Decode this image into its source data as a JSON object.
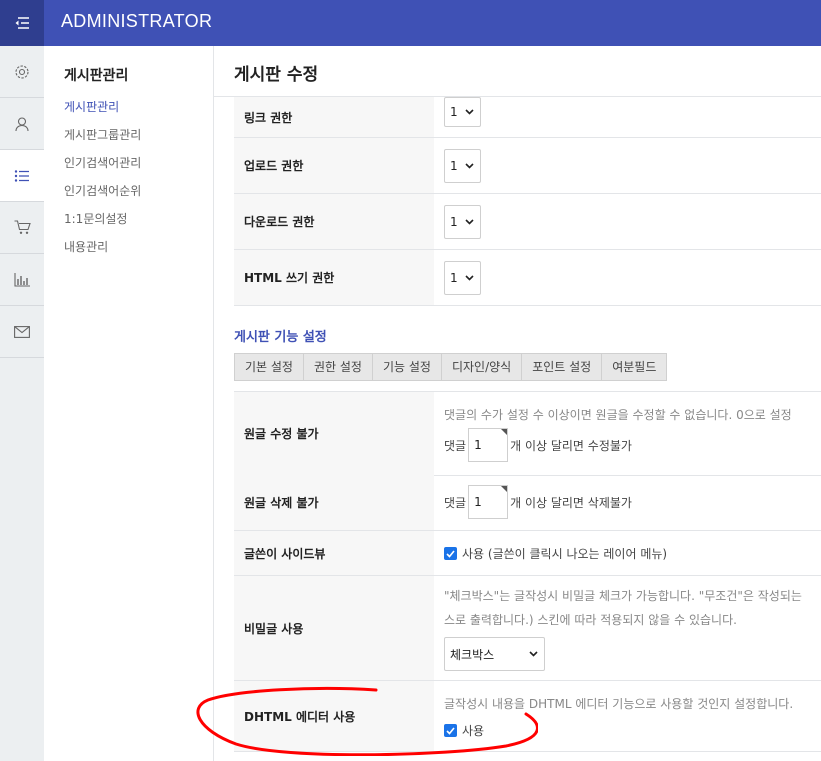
{
  "header": {
    "title": "ADMINISTRATOR"
  },
  "iconbar": [
    "gear-icon",
    "user-icon",
    "list-icon",
    "cart-icon",
    "chart-icon",
    "mail-icon"
  ],
  "sidebar": {
    "title": "게시판관리",
    "items": [
      {
        "label": "게시판관리"
      },
      {
        "label": "게시판그룹관리"
      },
      {
        "label": "인기검색어관리"
      },
      {
        "label": "인기검색어순위"
      },
      {
        "label": "1:1문의설정"
      },
      {
        "label": "내용관리"
      }
    ]
  },
  "main": {
    "title": "게시판 수정",
    "permissions": [
      {
        "label": "링크 권한",
        "value": "1"
      },
      {
        "label": "업로드 권한",
        "value": "1"
      },
      {
        "label": "다운로드 권한",
        "value": "1"
      },
      {
        "label": "HTML 쓰기 권한",
        "value": "1"
      }
    ],
    "section_title": "게시판 기능 설정",
    "tabs": [
      "기본 설정",
      "권한 설정",
      "기능 설정",
      "디자인/양식",
      "포인트 설정",
      "여분필드"
    ],
    "features": {
      "edit_lock": {
        "label": "원글 수정 불가",
        "desc": "댓글의 수가 설정 수 이상이면 원글을 수정할 수 없습니다. 0으로 설정",
        "prefix": "댓글",
        "value": "1",
        "suffix": "개 이상 달리면 수정불가"
      },
      "delete_lock": {
        "label": "원글 삭제 불가",
        "prefix": "댓글",
        "value": "1",
        "suffix": "개 이상 달리면 삭제불가"
      },
      "sideview": {
        "label": "글쓴이 사이드뷰",
        "checked": true,
        "checkbox_label": "사용 (글쓴이 클릭시 나오는 레이어 메뉴)"
      },
      "secret": {
        "label": "비밀글 사용",
        "desc_line1": "\"체크박스\"는 글작성시 비밀글 체크가 가능합니다. \"무조건\"은 작성되는",
        "desc_line2": "스로 출력합니다.) 스킨에 따라 적용되지 않을 수 있습니다.",
        "select_value": "체크박스"
      },
      "dhtml": {
        "label": "DHTML 에디터 사용",
        "desc": "글작성시 내용을 DHTML 에디터 기능으로 사용할 것인지 설정합니다.",
        "checked": true,
        "checkbox_label": "사용"
      }
    }
  },
  "annotation": {
    "color": "#ff0000"
  },
  "colors": {
    "primary": "#3f51b5",
    "primary_dark": "#2f3e8f",
    "checkbox": "#1a73e8"
  }
}
